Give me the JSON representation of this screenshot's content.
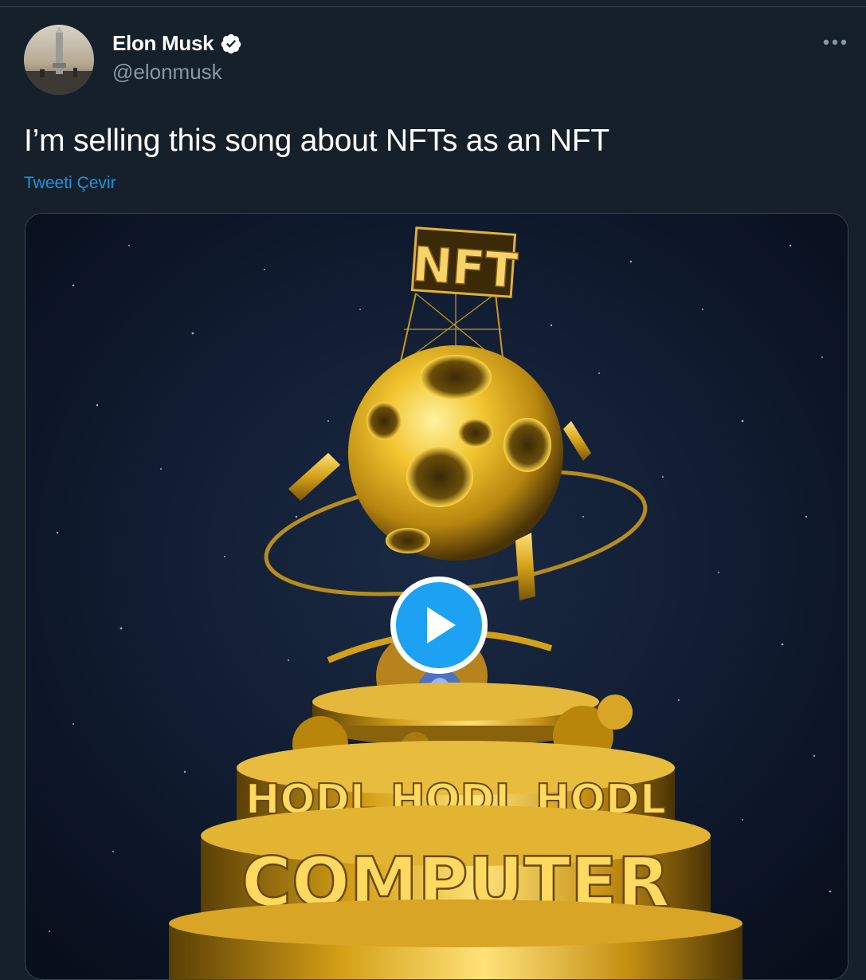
{
  "tweet": {
    "author": {
      "display_name": "Elon Musk",
      "handle": "@elonmusk",
      "verified": true,
      "avatar_icon": "starship-avatar"
    },
    "more_icon": "more-options-icon",
    "text": "I’m selling this song about NFTs as an NFT",
    "translate_label": "Tweeti Çevir",
    "media": {
      "type": "video",
      "play_icon": "play-icon",
      "artwork_text": {
        "sign": "NFT",
        "ring_top": "HODL HODL HODL",
        "ring_bottom": "COMPUTER"
      }
    }
  },
  "colors": {
    "background": "#15202b",
    "border": "#38444d",
    "primary_text": "#ffffff",
    "secondary_text": "#8899a6",
    "link": "#1b95e0",
    "accent": "#1da1f2",
    "gold": "#d4a017"
  }
}
